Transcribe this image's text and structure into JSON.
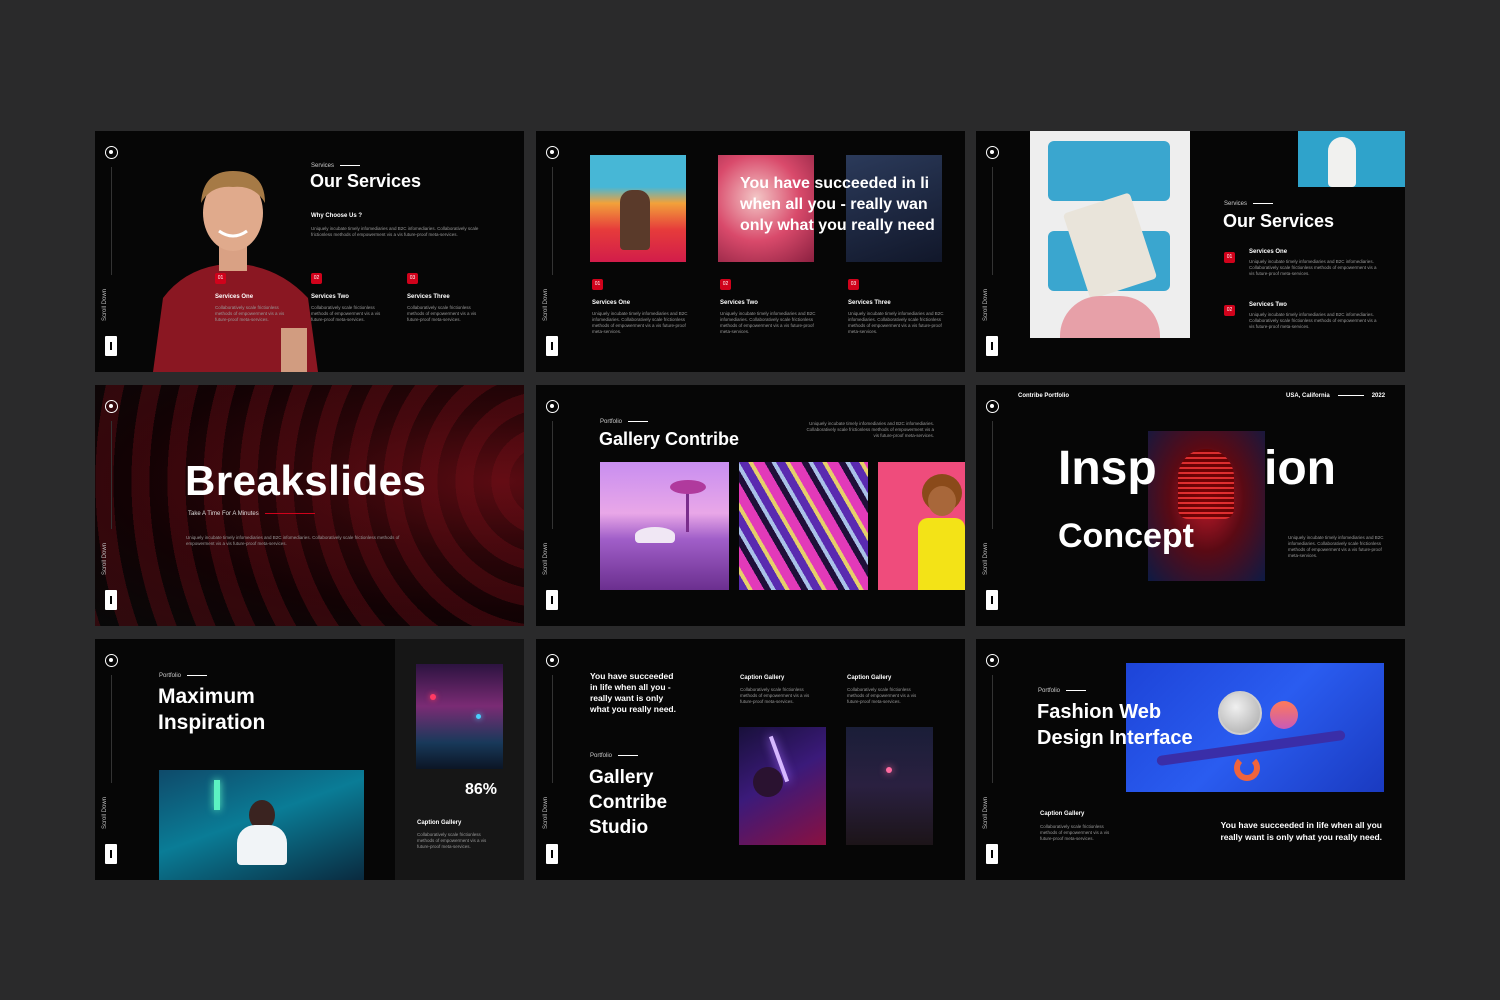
{
  "scroll_label": "Scroll Down",
  "slide1": {
    "kicker": "Services",
    "title": "Our Services",
    "why": "Why Choose Us ?",
    "intro": "Uniquely incubate timely infomediaries and B2C infomediaries. Collaboratively scale frictionless methods of empowerment vis a vis future-proof meta-services.",
    "services": [
      {
        "num": "01",
        "title": "Services One",
        "desc": "Collaboratively scale frictionless methods of empowerment vis a vis future-proof meta-services."
      },
      {
        "num": "02",
        "title": "Services Two",
        "desc": "Collaboratively scale frictionless methods of empowerment vis a vis future-proof meta-services."
      },
      {
        "num": "03",
        "title": "Services Three",
        "desc": "Collaboratively scale frictionless methods of empowerment vis a vis future-proof meta-services."
      }
    ]
  },
  "slide2": {
    "quote_l1": "You have succeeded in li",
    "quote_l2": "when all you - really wan",
    "quote_l3": "only what you really need",
    "services": [
      {
        "num": "01",
        "title": "Services One",
        "desc": "Uniquely incubate timely infomediaries and B2C infomediaries. Collaboratively scale frictionless methods of empowerment vis a vis future-proof meta-services."
      },
      {
        "num": "02",
        "title": "Services Two",
        "desc": "Uniquely incubate timely infomediaries and B2C infomediaries. Collaboratively scale frictionless methods of empowerment vis a vis future-proof meta-services."
      },
      {
        "num": "03",
        "title": "Services Three",
        "desc": "Uniquely incubate timely infomediaries and B2C infomediaries. Collaboratively scale frictionless methods of empowerment vis a vis future-proof meta-services."
      }
    ]
  },
  "slide3": {
    "kicker": "Services",
    "title": "Our Services",
    "services": [
      {
        "num": "01",
        "title": "Services One",
        "desc": "Uniquely incubate timely infomediaries and B2C infomediaries. Collaboratively scale frictionless methods of empowerment vis a vis future-proof meta-services."
      },
      {
        "num": "02",
        "title": "Services Two",
        "desc": "Uniquely incubate timely infomediaries and B2C infomediaries. Collaboratively scale frictionless methods of empowerment vis a vis future-proof meta-services."
      }
    ]
  },
  "slide4": {
    "title": "Breakslides",
    "subtitle": "Take A Time For A Minutes",
    "desc": "Uniquely incubate timely infomediaries and B2C infomediaries. Collaboratively scale frictionless methods of empowerment vis a vis future-proof meta-services."
  },
  "slide5": {
    "kicker": "Portfolio",
    "title": "Gallery Contribe",
    "desc": "Uniquely incubate timely infomediaries and B2C infomediaries. Collaboratively scale frictionless methods of empowerment vis a vis future-proof meta-services."
  },
  "slide6": {
    "brand": "Contribe Portfolio",
    "location": "USA, California",
    "year": "2022",
    "title_left": "Insp",
    "title_right": "ion",
    "title2": "Concept",
    "desc": "Uniquely incubate timely infomediaries and B2C infomediaries. Collaboratively scale frictionless methods of empowerment vis a vis future-proof meta-services."
  },
  "slide7": {
    "kicker": "Portfolio",
    "title_l1": "Maximum",
    "title_l2": "Inspiration",
    "percent": "86%",
    "caption": "Caption Gallery",
    "desc": "Collaboratively scale frictionless methods of empowerment vis a vis future-proof meta-services."
  },
  "slide8": {
    "quote_l1": "You have succeeded",
    "quote_l2": "in life when all you -",
    "quote_l3": "really want is only",
    "quote_l4": "what you really need.",
    "kicker": "Portfolio",
    "title_l1": "Gallery",
    "title_l2": "Contribe",
    "title_l3": "Studio",
    "captions": [
      {
        "title": "Caption Gallery",
        "desc": "Collaboratively scale frictionless methods of empowerment vis a vis future-proof meta-services."
      },
      {
        "title": "Caption Gallery",
        "desc": "Collaboratively scale frictionless methods of empowerment vis a vis future-proof meta-services."
      }
    ]
  },
  "slide9": {
    "kicker": "Portfolio",
    "title_l1": "Fashion Web",
    "title_l2": "Design Interface",
    "caption": "Caption Gallery",
    "desc": "Collaboratively scale frictionless methods of empowerment vis a vis future-proof meta-services.",
    "quote_l1": "You have succeeded in life when all you",
    "quote_l2": "really want is only what you really need."
  }
}
